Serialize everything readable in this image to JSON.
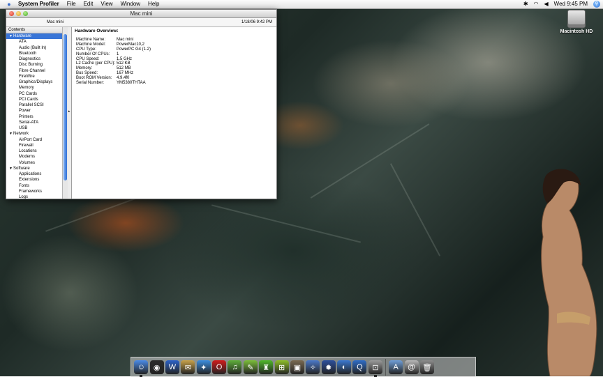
{
  "menubar": {
    "app_name": "System Profiler",
    "menus": [
      "File",
      "Edit",
      "View",
      "Window",
      "Help"
    ],
    "clock": "Wed 9:45 PM"
  },
  "desktop": {
    "hd_label": "Macintosh HD"
  },
  "window": {
    "title": "Mac mini",
    "machine_label": "Mac mini",
    "timestamp": "1/18/06 9:42 PM",
    "sidebar": {
      "header": "Contents",
      "groups": [
        {
          "label": "Hardware",
          "items": [
            "ATA",
            "Audio (Built In)",
            "Bluetooth",
            "Diagnostics",
            "Disc Burning",
            "Fibre Channel",
            "FireWire",
            "Graphics/Displays",
            "Memory",
            "PC Cards",
            "PCI Cards",
            "Parallel SCSI",
            "Power",
            "Printers",
            "Serial-ATA",
            "USB"
          ]
        },
        {
          "label": "Network",
          "items": [
            "AirPort Card",
            "Firewall",
            "Locations",
            "Modems",
            "Volumes"
          ]
        },
        {
          "label": "Software",
          "items": [
            "Applications",
            "Extensions",
            "Fonts",
            "Frameworks",
            "Logs"
          ]
        }
      ]
    },
    "detail": {
      "title": "Hardware Overview:",
      "rows": [
        {
          "k": "Machine Name:",
          "v": "Mac mini"
        },
        {
          "k": "Machine Model:",
          "v": "PowerMac10,2"
        },
        {
          "k": "CPU Type:",
          "v": "PowerPC G4 (1.2)"
        },
        {
          "k": "Number Of CPUs:",
          "v": "1"
        },
        {
          "k": "CPU Speed:",
          "v": "1.5 GHz"
        },
        {
          "k": "L2 Cache (per CPU):",
          "v": "512 KB"
        },
        {
          "k": "Memory:",
          "v": "512 MB"
        },
        {
          "k": "Bus Speed:",
          "v": "167 MHz"
        },
        {
          "k": "Boot ROM Version:",
          "v": "4.9.4f0"
        },
        {
          "k": "Serial Number:",
          "v": "YM5380THTAA"
        }
      ]
    }
  },
  "dock": {
    "items": [
      {
        "name": "finder-icon",
        "color": "#4a8be8",
        "glyph": "☺",
        "running": true
      },
      {
        "name": "dashboard-icon",
        "color": "#2b2b2b",
        "glyph": "◉",
        "running": false
      },
      {
        "name": "word-icon",
        "color": "#2c62c9",
        "glyph": "W",
        "running": false
      },
      {
        "name": "mail-icon",
        "color": "#c8a24a",
        "glyph": "✉",
        "running": false
      },
      {
        "name": "safari-icon",
        "color": "#3b8ee0",
        "glyph": "✦",
        "running": false
      },
      {
        "name": "opera-icon",
        "color": "#d01c1c",
        "glyph": "O",
        "running": false
      },
      {
        "name": "itunes-icon",
        "color": "#5fae3b",
        "glyph": "♫",
        "running": false
      },
      {
        "name": "text-editor-icon",
        "color": "#7cbf3a",
        "glyph": "✎",
        "running": false
      },
      {
        "name": "chess-icon",
        "color": "#4fb82a",
        "glyph": "♜",
        "running": false
      },
      {
        "name": "network-utility-icon",
        "color": "#8fbf2a",
        "glyph": "⊞",
        "running": false
      },
      {
        "name": "iphoto-icon",
        "color": "#7a6a52",
        "glyph": "▣",
        "running": false
      },
      {
        "name": "network-globe-icon",
        "color": "#4b79c8",
        "glyph": "✧",
        "running": false
      },
      {
        "name": "imovie-icon",
        "color": "#2d4f9c",
        "glyph": "✹",
        "running": false
      },
      {
        "name": "messenger-icon",
        "color": "#3a78d0",
        "glyph": "◐",
        "running": false
      },
      {
        "name": "quicktime-icon",
        "color": "#2f6dc7",
        "glyph": "Q",
        "running": false
      },
      {
        "name": "system-profiler-icon",
        "color": "#9b9b9b",
        "glyph": "⊡",
        "running": true
      },
      {
        "name": "applications-folder-icon",
        "color": "#6f9ed8",
        "glyph": "A",
        "running": false
      },
      {
        "name": "downloads-icon",
        "color": "#b8b8b8",
        "glyph": "@",
        "running": false
      },
      {
        "name": "trash-icon",
        "color": "#8c8c8c",
        "glyph": "🗑",
        "running": false
      }
    ]
  }
}
